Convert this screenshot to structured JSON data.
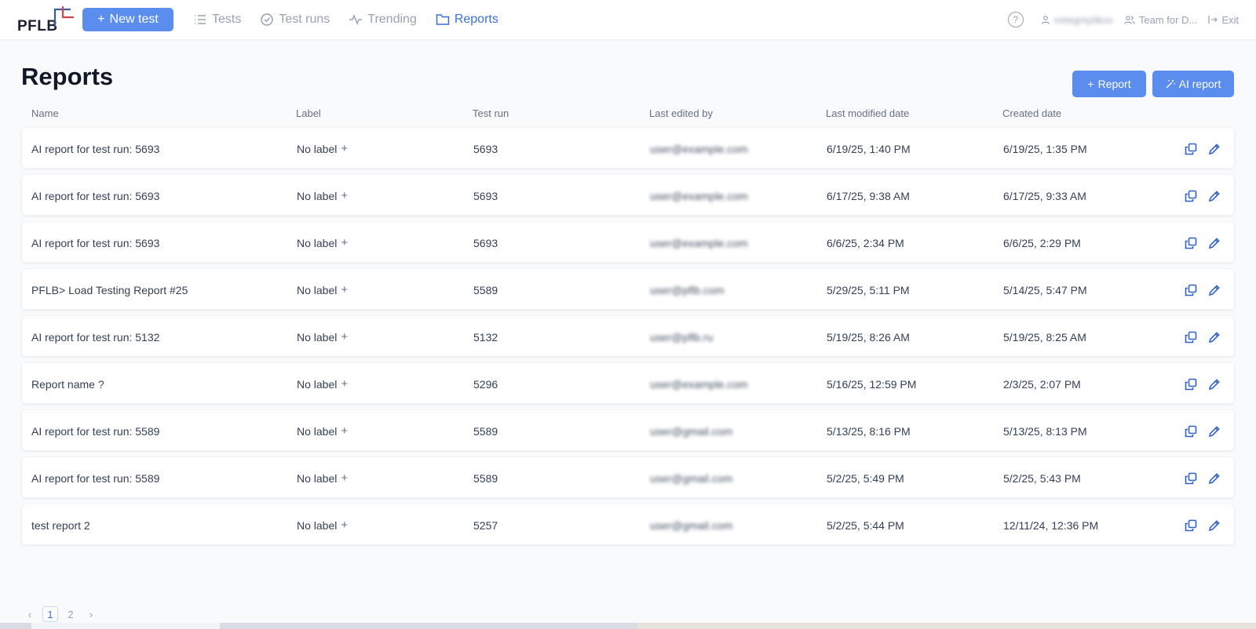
{
  "app": {
    "logo_text": "PFLB",
    "new_test_label": "New test"
  },
  "nav": {
    "items": [
      {
        "label": "Tests",
        "icon": "list-icon"
      },
      {
        "label": "Test runs",
        "icon": "check-circle-icon"
      },
      {
        "label": "Trending",
        "icon": "activity-icon"
      },
      {
        "label": "Reports",
        "icon": "folder-icon",
        "active": true
      }
    ]
  },
  "top_right": {
    "user": "nstegniytikov",
    "team": "Team for D...",
    "exit": "Exit"
  },
  "page": {
    "title": "Reports",
    "report_button": "Report",
    "ai_report_button": "AI report"
  },
  "table": {
    "columns": [
      "Name",
      "Label",
      "Test run",
      "Last edited by",
      "Last modified date",
      "Created date"
    ],
    "rows": [
      {
        "name": "AI report for test run: 5693",
        "label": "No label",
        "test_run": "5693",
        "editor": "user@example.com",
        "modified": "6/19/25, 1:40 PM",
        "created": "6/19/25, 1:35 PM"
      },
      {
        "name": "AI report for test run: 5693",
        "label": "No label",
        "test_run": "5693",
        "editor": "user@example.com",
        "modified": "6/17/25, 9:38 AM",
        "created": "6/17/25, 9:33 AM"
      },
      {
        "name": "AI report for test run: 5693",
        "label": "No label",
        "test_run": "5693",
        "editor": "user@example.com",
        "modified": "6/6/25, 2:34 PM",
        "created": "6/6/25, 2:29 PM"
      },
      {
        "name": "PFLB> Load Testing Report #25",
        "label": "No label",
        "test_run": "5589",
        "editor": "user@pflb.com",
        "modified": "5/29/25, 5:11 PM",
        "created": "5/14/25, 5:47 PM"
      },
      {
        "name": "AI report for test run: 5132",
        "label": "No label",
        "test_run": "5132",
        "editor": "user@pflb.ru",
        "modified": "5/19/25, 8:26 AM",
        "created": "5/19/25, 8:25 AM"
      },
      {
        "name": "Report name ?",
        "label": "No label",
        "test_run": "5296",
        "editor": "user@example.com",
        "modified": "5/16/25, 12:59 PM",
        "created": "2/3/25, 2:07 PM"
      },
      {
        "name": "AI report for test run: 5589",
        "label": "No label",
        "test_run": "5589",
        "editor": "user@gmail.com",
        "modified": "5/13/25, 8:16 PM",
        "created": "5/13/25, 8:13 PM"
      },
      {
        "name": "AI report for test run: 5589",
        "label": "No label",
        "test_run": "5589",
        "editor": "user@gmail.com",
        "modified": "5/2/25, 5:49 PM",
        "created": "5/2/25, 5:43 PM"
      },
      {
        "name": "test report 2",
        "label": "No label",
        "test_run": "5257",
        "editor": "user@gmail.com",
        "modified": "5/2/25, 5:44 PM",
        "created": "12/11/24, 12:36 PM"
      }
    ]
  },
  "pagination": {
    "pages": [
      "1",
      "2"
    ],
    "current": "1"
  },
  "colors": {
    "accent": "#5b8def",
    "active_nav": "#3a6fd8",
    "logo_red": "#d64545"
  }
}
